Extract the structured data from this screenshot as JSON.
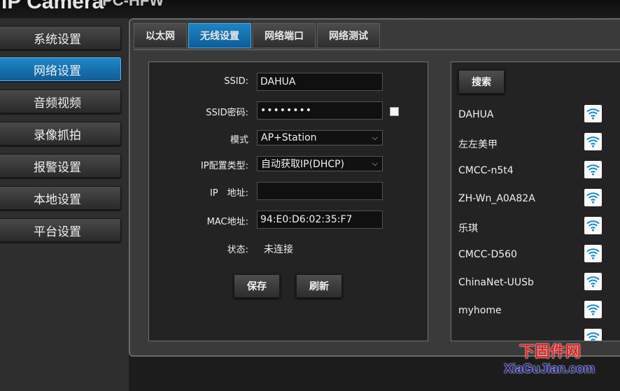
{
  "header": {
    "title": "IP Camera",
    "subtitle": "IPC-HFW"
  },
  "sidebar": {
    "items": [
      {
        "label": "系统设置",
        "active": false
      },
      {
        "label": "网络设置",
        "active": true
      },
      {
        "label": "音频视频",
        "active": false
      },
      {
        "label": "录像抓拍",
        "active": false
      },
      {
        "label": "报警设置",
        "active": false
      },
      {
        "label": "本地设置",
        "active": false
      },
      {
        "label": "平台设置",
        "active": false
      }
    ]
  },
  "tabs": [
    {
      "label": "以太网",
      "active": false
    },
    {
      "label": "无线设置",
      "active": true
    },
    {
      "label": "网络端口",
      "active": false
    },
    {
      "label": "网络测试",
      "active": false
    }
  ],
  "form": {
    "ssid_label": "SSID:",
    "ssid_value": "DAHUA",
    "password_label": "SSID密码:",
    "password_value": "••••••••",
    "mode_label": "模式",
    "mode_value": "AP+Station",
    "ipconfig_label": "IP配置类型:",
    "ipconfig_value": "自动获取IP(DHCP)",
    "ip_label": "IP　地址:",
    "ip_value": "",
    "mac_label": "MAC地址:",
    "mac_value": "94:E0:D6:02:35:F7",
    "status_label": "状态:",
    "status_value": "未连接",
    "save_label": "保存",
    "refresh_label": "刷新"
  },
  "wifi": {
    "search_label": "搜索",
    "networks": [
      "DAHUA",
      "左左美甲",
      "CMCC-n5t4",
      "ZH-Wn_A0A82A",
      "乐琪",
      "CMCC-D560",
      "ChinaNet-UUSb",
      "myhome",
      ""
    ]
  },
  "watermark": {
    "top": "下固件网",
    "bottom": "XiaGuJian.com"
  },
  "colors": {
    "accent": "#1578b8",
    "background": "#1c1c1c",
    "panel": "#232323"
  }
}
